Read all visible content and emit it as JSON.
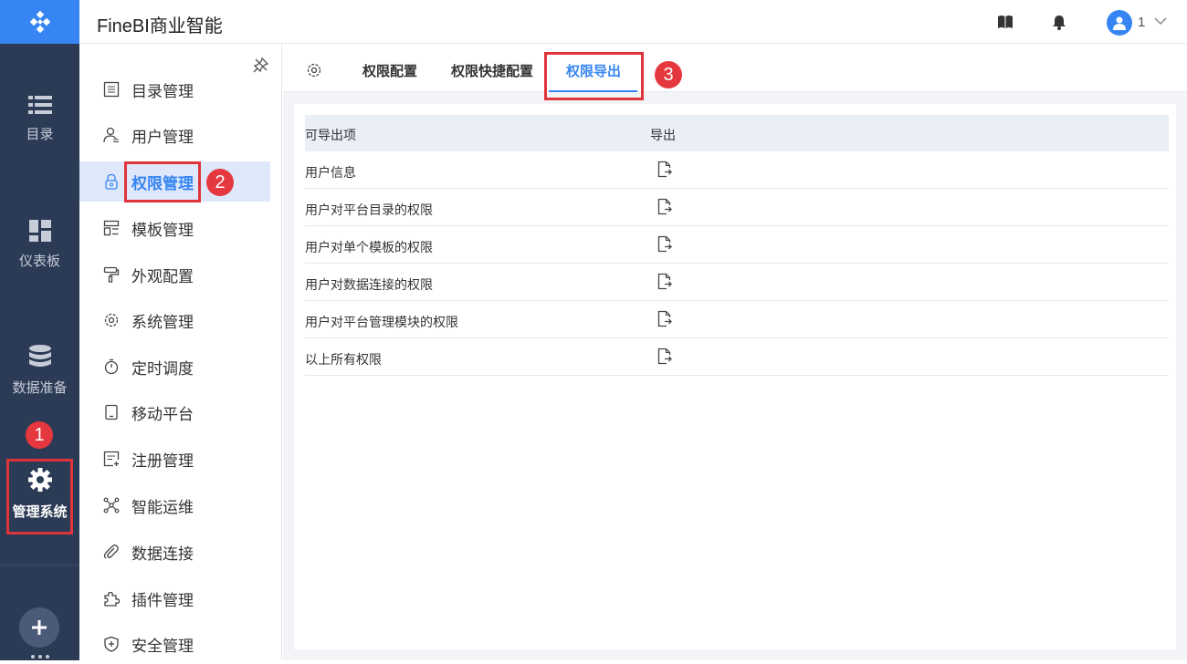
{
  "app": {
    "title": "FineBI商业智能"
  },
  "header": {
    "user_name": "1",
    "icons": [
      "help-book-icon",
      "bell-icon",
      "user-avatar-icon",
      "chevron-down-icon"
    ]
  },
  "rail": {
    "items": [
      {
        "label": "目录",
        "icon": "list-icon"
      },
      {
        "label": "仪表板",
        "icon": "dashboard-icon"
      },
      {
        "label": "数据准备",
        "icon": "database-icon"
      },
      {
        "label": "管理系统",
        "icon": "gear-icon",
        "active": true
      }
    ]
  },
  "sidebar": {
    "items": [
      {
        "label": "目录管理",
        "icon": "directory-icon"
      },
      {
        "label": "用户管理",
        "icon": "user-icon"
      },
      {
        "label": "权限管理",
        "icon": "lock-icon",
        "active": true
      },
      {
        "label": "模板管理",
        "icon": "template-icon"
      },
      {
        "label": "外观配置",
        "icon": "paint-roller-icon"
      },
      {
        "label": "系统管理",
        "icon": "gear-icon"
      },
      {
        "label": "定时调度",
        "icon": "timer-icon"
      },
      {
        "label": "移动平台",
        "icon": "mobile-icon"
      },
      {
        "label": "注册管理",
        "icon": "register-icon"
      },
      {
        "label": "智能运维",
        "icon": "network-icon"
      },
      {
        "label": "数据连接",
        "icon": "paperclip-icon"
      },
      {
        "label": "插件管理",
        "icon": "puzzle-icon"
      },
      {
        "label": "安全管理",
        "icon": "shield-icon"
      }
    ]
  },
  "tabs": [
    {
      "label": "权限配置"
    },
    {
      "label": "权限快捷配置"
    },
    {
      "label": "权限导出",
      "active": true
    }
  ],
  "table": {
    "columns": [
      "可导出项",
      "导出"
    ],
    "rows": [
      {
        "name": "用户信息"
      },
      {
        "name": "用户对平台目录的权限"
      },
      {
        "name": "用户对单个模板的权限"
      },
      {
        "name": "用户对数据连接的权限"
      },
      {
        "name": "用户对平台管理模块的权限"
      },
      {
        "name": "以上所有权限"
      }
    ]
  },
  "annotations": {
    "step1": "1",
    "step2": "2",
    "step3": "3"
  },
  "colors": {
    "accent": "#3685f2",
    "rail_bg": "#2b3a55",
    "callout": "#e0343b"
  }
}
